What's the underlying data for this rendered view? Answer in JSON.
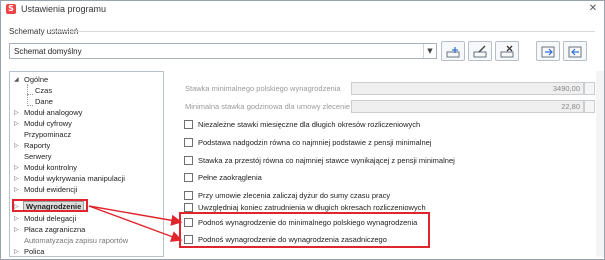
{
  "window": {
    "title": "Ustawienia programu",
    "app_icon_glyph": "S",
    "controls": {
      "close_glyph": "✕"
    }
  },
  "schemes": {
    "group_label": "Schematy ustawień",
    "selected": "Schemat domyślny",
    "dropdown_glyph": "▼",
    "toolbar": [
      {
        "name": "add-scheme-button",
        "icon": "add-document-icon"
      },
      {
        "name": "edit-scheme-button",
        "icon": "edit-document-icon"
      },
      {
        "name": "delete-scheme-button",
        "icon": "delete-document-icon"
      },
      {
        "name": "export-scheme-button",
        "icon": "export-arrow-icon"
      },
      {
        "name": "import-scheme-button",
        "icon": "import-arrow-icon"
      }
    ]
  },
  "tree": {
    "items": [
      {
        "label": "Ogólne",
        "expanded": true
      },
      {
        "label": "Czas"
      },
      {
        "label": "Dane"
      },
      {
        "label": "Moduł analogowy"
      },
      {
        "label": "Moduł cyfrowy"
      },
      {
        "label": "Przypominacz"
      },
      {
        "label": "Raporty"
      },
      {
        "label": "Serwery"
      },
      {
        "label": "Moduł kontrolny"
      },
      {
        "label": "Moduł wykrywania manipulacji"
      },
      {
        "label": "Moduł ewidencji"
      },
      {
        "label": "Wynagrodzenie",
        "selected": true
      },
      {
        "label": "Moduł delegacji"
      },
      {
        "label": "Płaca zagraniczna"
      },
      {
        "label": "Automatyzacja zapisu raportów"
      },
      {
        "label": "Polica"
      }
    ],
    "expander_collapsed": "▷",
    "expander_expanded": "◢"
  },
  "settings": {
    "min_wage_label": "Stawka minimalnego polskiego wynagrodzenia",
    "min_wage_value": "3490,00",
    "min_hourly_label": "Minimalna stawka godzinowa dla umowy zlecenie",
    "min_hourly_value": "22,80",
    "options": [
      {
        "label": "Niezależne stawki miesięczne dla długich okresów rozliczeniowych",
        "checked": false
      },
      {
        "label": "Podstawa nadgodzin równa co najmniej podstawie z pensji minimalnej",
        "checked": false
      },
      {
        "label": "Stawka za przestój równa co najmniej stawce wynikającej z pensji minimalnej",
        "checked": false
      },
      {
        "label": "Pełne zaokrąglenia",
        "checked": false
      },
      {
        "label": "Przy umowie zlecenia zaliczaj dyżur do sumy czasu pracy",
        "checked": false
      },
      {
        "label": "Uwzględniaj koniec zatrudnienia w długich okresach rozliczeniowych",
        "checked": false
      },
      {
        "label": "Podnoś wynagrodzenie do minimalnego polskiego wynagrodzenia",
        "checked": false
      },
      {
        "label": "Podnoś wynagrodzenie do wynagrodzenia zasadniczego",
        "checked": false
      }
    ]
  },
  "colors": {
    "highlight": "#e0262c",
    "selection_bg": "#dcdcdc"
  }
}
